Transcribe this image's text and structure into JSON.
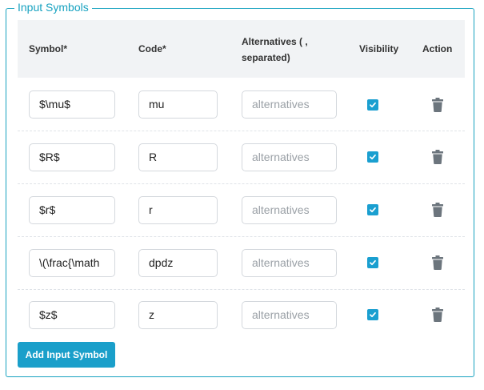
{
  "panel": {
    "legend": "Input Symbols"
  },
  "table": {
    "headers": {
      "symbol": "Symbol*",
      "code": "Code*",
      "alternatives_line1": "Alternatives ( ,",
      "alternatives_line2": "separated)",
      "visibility": "Visibility",
      "action": "Action"
    },
    "alternatives_placeholder": "alternatives",
    "rows": [
      {
        "symbol": "$\\mu$",
        "code": "mu",
        "alternatives": "",
        "visible": true
      },
      {
        "symbol": "$R$",
        "code": "R",
        "alternatives": "",
        "visible": true
      },
      {
        "symbol": "$r$",
        "code": "r",
        "alternatives": "",
        "visible": true
      },
      {
        "symbol": "\\(\\frac{\\math",
        "code": "dpdz",
        "alternatives": "",
        "visible": true
      },
      {
        "symbol": "$z$",
        "code": "z",
        "alternatives": "",
        "visible": true
      }
    ]
  },
  "add_button": {
    "label": "Add Input Symbol"
  },
  "colors": {
    "accent": "#17a2c0",
    "checkbox": "#1a9fd0",
    "trash": "#6c757d"
  },
  "icons": {
    "check": "check-icon",
    "delete": "trash-icon"
  }
}
